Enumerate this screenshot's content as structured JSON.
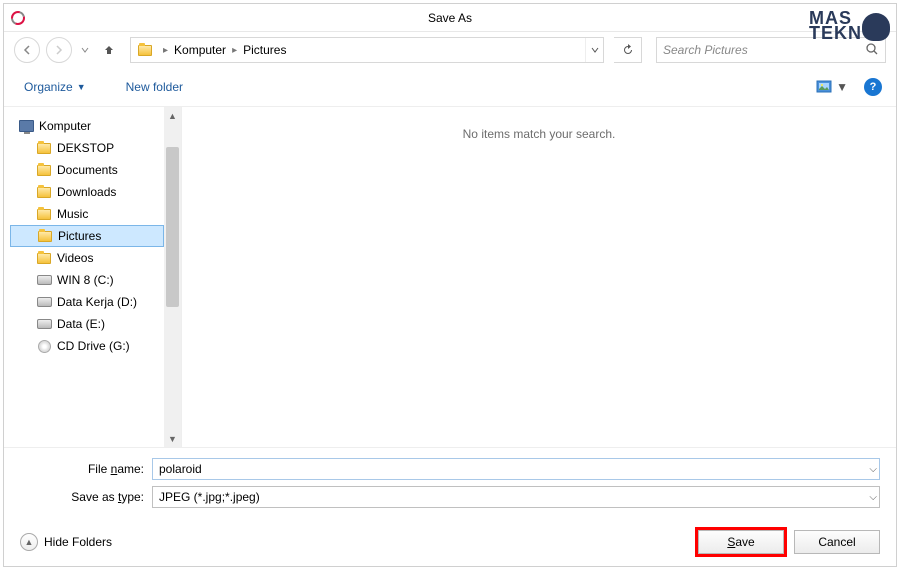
{
  "titlebar": {
    "title": "Save As"
  },
  "watermark": {
    "line1": "MAS",
    "line2": "TEKN"
  },
  "nav": {
    "breadcrumb": [
      "Komputer",
      "Pictures"
    ],
    "search_placeholder": "Search Pictures"
  },
  "toolbar": {
    "organize": "Organize",
    "newfolder": "New folder"
  },
  "tree": {
    "root": "Komputer",
    "items": [
      {
        "label": "DEKSTOP",
        "icon": "folder"
      },
      {
        "label": "Documents",
        "icon": "folder"
      },
      {
        "label": "Downloads",
        "icon": "folder"
      },
      {
        "label": "Music",
        "icon": "folder"
      },
      {
        "label": "Pictures",
        "icon": "folder",
        "selected": true
      },
      {
        "label": "Videos",
        "icon": "folder"
      },
      {
        "label": "WIN 8 (C:)",
        "icon": "drive"
      },
      {
        "label": "Data Kerja (D:)",
        "icon": "drive"
      },
      {
        "label": "Data  (E:)",
        "icon": "drive"
      },
      {
        "label": "CD Drive (G:)",
        "icon": "cd"
      }
    ]
  },
  "content": {
    "empty_text": "No items match your search."
  },
  "form": {
    "filename_label": "File name:",
    "filename_value": "polaroid",
    "type_label": "Save as type:",
    "type_value": "JPEG (*.jpg;*.jpeg)"
  },
  "footer": {
    "hide_folders": "Hide Folders",
    "save": "Save",
    "cancel": "Cancel"
  }
}
